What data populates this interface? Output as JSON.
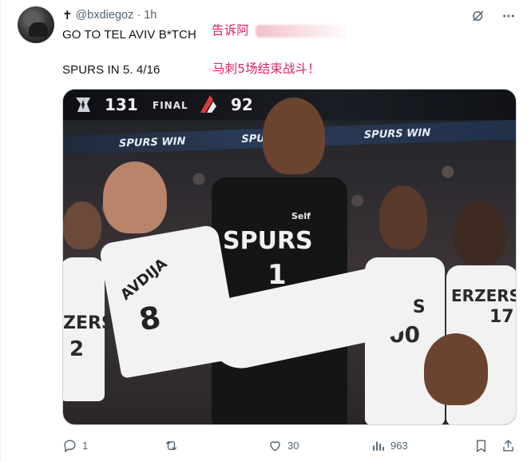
{
  "tweet": {
    "author_handle": "@bxdiegoz",
    "author_symbol": "✝",
    "time": "1h",
    "line1": "GO TO TEL AVIV B*TCH",
    "line1_translation": "告诉阿",
    "line2": "SPURS IN 5.  4/16",
    "line2_translation": "马刺5场结束战斗！"
  },
  "media": {
    "scoreboard": {
      "home_score": "131",
      "status": "FINAL",
      "away_score": "92"
    },
    "ribbon_text": [
      "SPURS WIN",
      "SPURS WIN",
      "SPURS WIN"
    ],
    "jerseys": {
      "center_top": "SPURS",
      "center_number": "1",
      "sponsor": "Self",
      "left_name": "AVDIJA",
      "left_number": "8",
      "right1": "ZERS",
      "right1_num": "00",
      "right2": "ERZERS",
      "right2_num": "17",
      "left_back": "ZERS",
      "left_back_num": "2"
    }
  },
  "actions": {
    "reply_count": "1",
    "retweet_count": "",
    "like_count": "30",
    "view_count": "963"
  },
  "colors": {
    "text": "#0f1419",
    "muted": "#536471",
    "translation": "#e0245e"
  },
  "icons": [
    "grok-icon",
    "more-icon",
    "reply-icon",
    "retweet-icon",
    "like-icon",
    "views-icon",
    "bookmark-icon",
    "share-icon"
  ]
}
